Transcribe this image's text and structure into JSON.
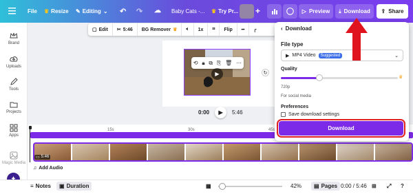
{
  "header": {
    "file": "File",
    "resize": "Resize",
    "editing": "Editing",
    "doc_title": "Baby Cats -...",
    "try_pro": "Try Pr...",
    "preview": "Preview",
    "download": "Download",
    "share": "Share"
  },
  "sidebar": {
    "items": [
      {
        "label": "Brand",
        "icon": "crown-icon"
      },
      {
        "label": "Uploads",
        "icon": "cloud-upload-icon"
      },
      {
        "label": "Tools",
        "icon": "pen-icon"
      },
      {
        "label": "Projects",
        "icon": "folder-icon"
      },
      {
        "label": "Apps",
        "icon": "apps-grid-icon"
      },
      {
        "label": "Magic Media",
        "icon": "image-icon"
      }
    ]
  },
  "canvas_toolbar": {
    "edit": "Edit",
    "duration": "5:46",
    "bg_remover": "BG Remover",
    "speed": "1x",
    "flip": "Flip"
  },
  "player": {
    "current": "0:00",
    "total": "5:46"
  },
  "timeline": {
    "ticks": [
      "15s",
      "30s",
      "45s"
    ],
    "clip_duration": "5:46",
    "add_audio": "Add Audio"
  },
  "bottom": {
    "notes": "Notes",
    "duration": "Duration",
    "zoom": "42%",
    "pages": "Pages",
    "time": "0:00 / 5:46"
  },
  "download_panel": {
    "title": "Download",
    "file_type_label": "File type",
    "file_type_value": "MP4 Video",
    "badge": "Suggested",
    "quality_label": "Quality",
    "quality_value": "720p",
    "quality_note": "For social media",
    "quality_level": 0.33,
    "preferences_label": "Preferences",
    "save_settings": "Save download settings",
    "download_button": "Download"
  },
  "colors": {
    "accent": "#7d2ae8",
    "highlight_border": "#e02020",
    "arrow": "#e0141e"
  }
}
